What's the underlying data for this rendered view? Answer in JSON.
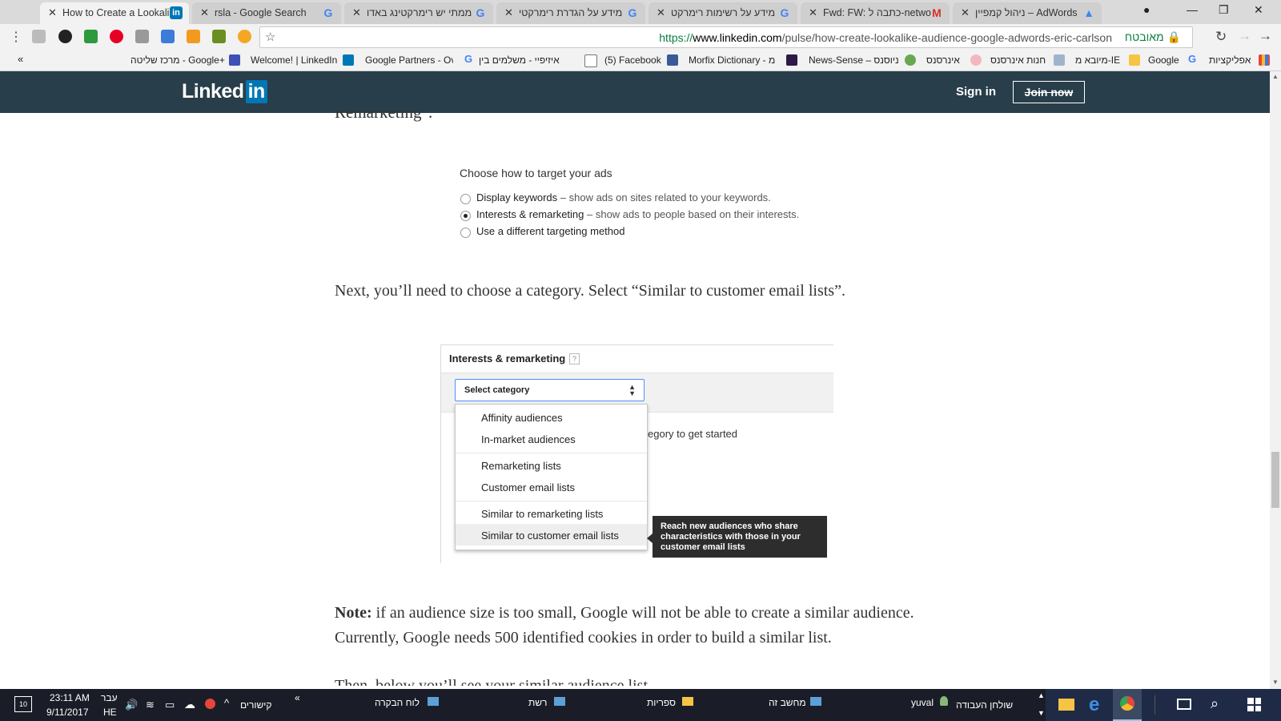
{
  "tabs": [
    {
      "title": "How to Create a Lookalik",
      "favicon": "linkedin-icon",
      "active": true
    },
    {
      "title": "rsla - Google Search",
      "favicon": "google-icon",
      "active": false
    },
    {
      "title": "ממתי יש רימרקטינג באדו",
      "favicon": "google-icon",
      "active": false
    },
    {
      "title": "מידע על הגדרת רימרקטי",
      "favicon": "google-icon",
      "active": false
    },
    {
      "title": "מידע על רשימות רימרקט",
      "favicon": "google-icon",
      "active": false
    },
    {
      "title": "Fwd: FW: כתבה ל-netwo",
      "favicon": "gmail-icon",
      "active": false
    },
    {
      "title": "ניהול קמפיין – AdWords",
      "favicon": "adwords-icon",
      "active": false
    }
  ],
  "toolbar": {
    "url_scheme": "https://",
    "url_host": "www.linkedin.com",
    "url_path": "/pulse/how-create-lookalike-audience-google-adwords-eric-carlson",
    "secure_label": "מאובטח"
  },
  "bookmarks": [
    {
      "label": "אפליקציות",
      "icon": "apps-icon"
    },
    {
      "label": "Google",
      "icon": "google-icon"
    },
    {
      "label": "מיובא מ-IE",
      "icon": "folder-icon"
    },
    {
      "label": "חנות אינרסנס",
      "icon": "store-icon"
    },
    {
      "label": "אינרסנס",
      "icon": "heart-icon"
    },
    {
      "label": "News-Sense – ניוסנס",
      "icon": "leaf-icon"
    },
    {
      "label": "Morfix Dictionary - מ",
      "icon": "morfix-icon"
    },
    {
      "label": "(5) Facebook",
      "icon": "facebook-icon"
    },
    {
      "label": "איזיפיי - משלמים בין",
      "icon": "page-icon"
    },
    {
      "label": "Google Partners - Ov",
      "icon": "google-icon"
    },
    {
      "label": "Welcome! | LinkedIn",
      "icon": "linkedin-icon"
    },
    {
      "label": "מרכז שליטה - Google+",
      "icon": "gplus-icon"
    }
  ],
  "linkedin": {
    "logo_text": "Linked",
    "logo_in": "in",
    "sign_in": "Sign in",
    "join_now": "Join now"
  },
  "article": {
    "cutoff_text": "Remarketing\".",
    "target_title": "Choose how to target your ads",
    "radio_options": [
      {
        "label": "Display keywords",
        "desc": " – show ads on sites related to your keywords.",
        "selected": false
      },
      {
        "label": "Interests & remarketing",
        "desc": " – show ads to people based on their interests.",
        "selected": true
      },
      {
        "label": "Use a different targeting method",
        "desc": "",
        "selected": false
      }
    ],
    "para1": "Next, you’ll need to choose a category. Select “Similar to customer email lists”.",
    "panel_title": "Interests & remarketing",
    "panel_help": "?",
    "select_label": "Select category",
    "hint": "egory to get started",
    "dropdown_items": [
      "Affinity audiences",
      "In-market audiences",
      "Remarketing lists",
      "Customer email lists",
      "Similar to remarketing lists",
      "Similar to customer email lists"
    ],
    "highlighted_item": "Similar to customer email lists",
    "tooltip": "Reach new audiences who share characteristics with those in your customer email lists",
    "note_label": "Note:",
    "note_text": " if an audience size is too small, Google will not be able to create a similar audience. Currently, Google needs 500 identified cookies in order to build a similar list.",
    "para3": "Then, below you’ll see your similar audience list."
  },
  "taskbar": {
    "time": "23:11 AM",
    "date": "9/11/2017",
    "lang_top": "עבר",
    "lang_bottom": "HE",
    "notif_count": "10",
    "links": "קישורים",
    "chevron": "«",
    "items": [
      "לוח הבקרה",
      "רשת",
      "ספריות",
      "מחשב זה"
    ],
    "user": "yuval",
    "desktop": "שולחן העבודה"
  },
  "colors": {
    "linkedin_header": "#283e4a",
    "linkedin_blue": "#0077b5",
    "secure_green": "#0b8043",
    "taskbar": "#1a1d27"
  }
}
